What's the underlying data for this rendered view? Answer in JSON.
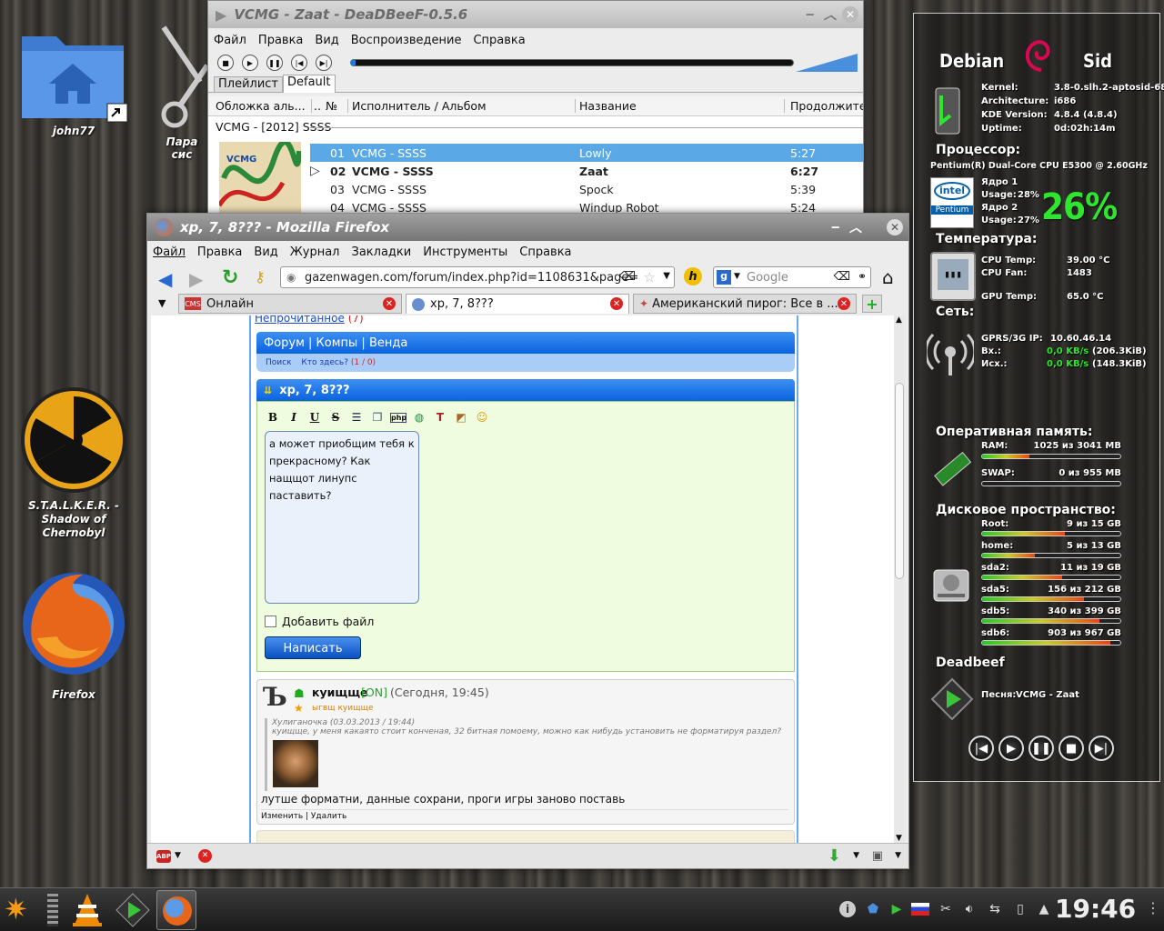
{
  "desktop": {
    "icons": [
      {
        "id": "home",
        "label": "john77"
      },
      {
        "id": "params",
        "label": "Пара\nсис"
      },
      {
        "id": "stalker",
        "label": "S.T.A.L.K.E.R. -\nShadow of\nChernobyl"
      },
      {
        "id": "firefox",
        "label": "Firefox"
      }
    ]
  },
  "deadbeef": {
    "title": "VCMG - Zaat - DeaDBeeF-0.5.6",
    "menu": [
      "Файл",
      "Правка",
      "Вид",
      "Воспроизведение",
      "Справка"
    ],
    "tabs": [
      "Плейлист",
      "Default"
    ],
    "columns": [
      "Обложка аль...",
      "..",
      "№",
      "Исполнитель / Альбом",
      "Название",
      "Продолжите"
    ],
    "group": "VCMG - [2012] SSSS",
    "cover_text": "VCMG",
    "tracks": [
      {
        "num": "01",
        "artist": "VCMG - SSSS",
        "title": "Lowly",
        "dur": "5:27"
      },
      {
        "num": "02",
        "artist": "VCMG - SSSS",
        "title": "Zaat",
        "dur": "6:27"
      },
      {
        "num": "03",
        "artist": "VCMG - SSSS",
        "title": "Spock",
        "dur": "5:39"
      },
      {
        "num": "04",
        "artist": "VCMG - SSSS",
        "title": "Windup Robot",
        "dur": "5:24"
      }
    ],
    "selected_track": 0,
    "playing_track": 1
  },
  "firefox": {
    "title": "xp, 7, 8??? - Mozilla Firefox",
    "menu": [
      "Файл",
      "Правка",
      "Вид",
      "Журнал",
      "Закладки",
      "Инструменты",
      "Справка"
    ],
    "url": "gazenwagen.com/forum/index.php?id=1108631&page=",
    "search_placeholder": "Google",
    "tabs": [
      {
        "label": "Онлайн",
        "favicon": "cms-icon"
      },
      {
        "label": "xp, 7, 8???",
        "favicon": "globe-icon"
      },
      {
        "label": "Американский пирог: Все в ...",
        "favicon": "film-icon"
      }
    ],
    "page": {
      "unread": "Непрочитанное",
      "unread_count": "(7)",
      "nav": "Форум | Компы | Венда",
      "nav_search": "Поиск",
      "nav_who": "Кто здесь?",
      "nav_who_count": "(1 / 0)",
      "thread_title": "xp, 7, 8???",
      "editor_buttons": [
        "B",
        "I",
        "U",
        "S"
      ],
      "message": "а может приобщим тебя к прекрасному? Как нащщот линупс паставить?",
      "attach_label": "Добавить файл",
      "submit_label": "Написать",
      "post": {
        "avatar_letter": "Ъ",
        "author": "куищще",
        "status": "[ON]",
        "time": "(Сегодня, 19:45)",
        "rank": "ыгвщ куищще",
        "quote_author": "Хулиганочка (03.03.2013 / 19:44)",
        "quote_text": "куищще, у меня какаято стоит конченая, 32 битная помоему, можно как нибудь установить не форматируя раздел?",
        "body": "лутше форматни, данные сохрани, проги игры заново поставь",
        "edit_link": "Изменить",
        "delete_link": "Удалить"
      }
    }
  },
  "conky": {
    "os_left": "Debian",
    "os_right": "Sid",
    "sys": [
      {
        "k": "Kernel:",
        "v": "3.8-0.slh.2-aptosid-686"
      },
      {
        "k": "Architecture:",
        "v": "i686"
      },
      {
        "k": "KDE Version:",
        "v": "4.8.4 (4.8.4)"
      },
      {
        "k": "Uptime:",
        "v": "0d:02h:14m"
      }
    ],
    "cpu_header": "Процессор:",
    "cpu_model": "Pentium(R) Dual-Core  CPU    E5300  @ 2.60GHz",
    "cores": [
      {
        "name": "Ядро 1",
        "usage_label": "Usage:",
        "usage": "28%"
      },
      {
        "name": "Ядро 2",
        "usage_label": "Usage:",
        "usage": "27%"
      }
    ],
    "cpu_total": "26%",
    "temp_header": "Температура:",
    "temps": [
      {
        "k": "CPU Temp:",
        "v": "39.00  °C"
      },
      {
        "k": "CPU Fan:",
        "v": "1483"
      },
      {
        "k": "GPU Temp:",
        "v": "65.0  °C"
      }
    ],
    "net_header": "Сеть:",
    "net": [
      {
        "k": "GPRS/3G IP:",
        "v": "10.60.46.14",
        "t": ""
      },
      {
        "k": "Вх.:",
        "v": "0,0 KB/s",
        "t": "(206.3KiB)"
      },
      {
        "k": "Исх.:",
        "v": "0,0 KB/s",
        "t": "(148.3KiB)"
      }
    ],
    "mem_header": "Оперативная память:",
    "mem": [
      {
        "k": "RAM:",
        "v": "1025 из 3041 MB",
        "frac": 0.34
      },
      {
        "k": "SWAP:",
        "v": "0 из 955 MB",
        "frac": 0.0
      }
    ],
    "disk_header": "Дисковое пространство:",
    "disks": [
      {
        "k": "Root:",
        "v": "9 из 15 GB",
        "frac": 0.6
      },
      {
        "k": "home:",
        "v": "5 из 13 GB",
        "frac": 0.38
      },
      {
        "k": "sda2:",
        "v": "11 из 19 GB",
        "frac": 0.58
      },
      {
        "k": "sda5:",
        "v": "156 из 212 GB",
        "frac": 0.74
      },
      {
        "k": "sdb5:",
        "v": "340 из 399 GB",
        "frac": 0.85
      },
      {
        "k": "sdb6:",
        "v": "903 из 967 GB",
        "frac": 0.93
      }
    ],
    "player_header": "Deadbeef",
    "song_label": "Песня:",
    "song": "VCMG - Zaat"
  },
  "taskbar": {
    "clock": "19:46"
  },
  "colors": {
    "accent": "#1c7cd6",
    "selected_row": "#5aa9e6",
    "conky_green": "#2ee62e"
  }
}
